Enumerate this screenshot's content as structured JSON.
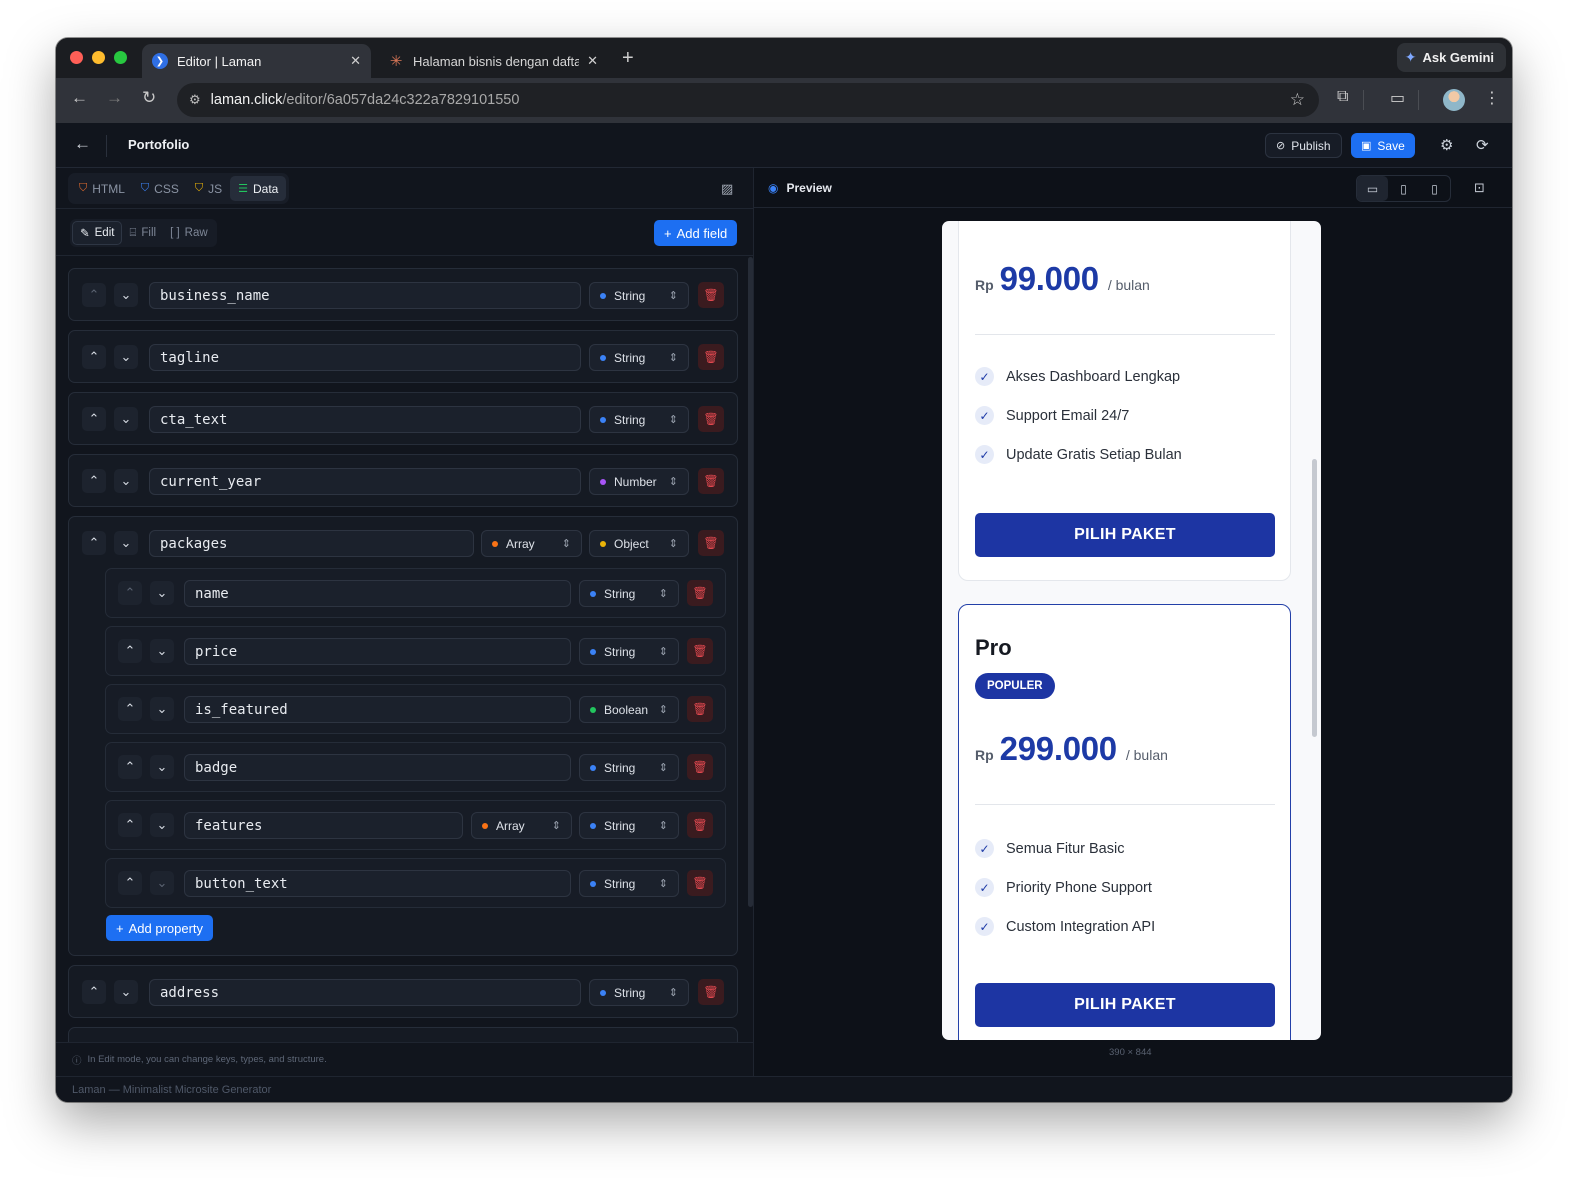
{
  "browser": {
    "tabs": [
      {
        "title": "Editor | Laman",
        "active": true
      },
      {
        "title": "Halaman bisnis dengan daftar",
        "active": false
      }
    ],
    "new_tab": "+",
    "ask_gemini": "Ask Gemini",
    "url_host": "laman.click",
    "url_path": "/editor/6a057da24c322a7829101550"
  },
  "app": {
    "project_title": "Portofolio",
    "publish_label": "Publish",
    "save_label": "Save",
    "footer": "Laman — Minimalist Microsite Generator"
  },
  "editor": {
    "lang_tabs": [
      {
        "label": "HTML",
        "icon": "html5-icon",
        "color": "#e06b2e"
      },
      {
        "label": "CSS",
        "icon": "css3-icon",
        "color": "#3b82f6"
      },
      {
        "label": "JS",
        "icon": "js-icon",
        "color": "#eab308"
      },
      {
        "label": "Data",
        "icon": "database-icon",
        "color": "#22c55e",
        "active": true
      }
    ],
    "modes": [
      {
        "label": "Edit",
        "active": true
      },
      {
        "label": "Fill"
      },
      {
        "label": "Raw"
      }
    ],
    "add_field_label": "Add field",
    "add_property_label": "Add property",
    "hint": "In Edit mode, you can change keys, types, and structure.",
    "fields": [
      {
        "key": "business_name",
        "type": "String"
      },
      {
        "key": "tagline",
        "type": "String"
      },
      {
        "key": "cta_text",
        "type": "String"
      },
      {
        "key": "current_year",
        "type": "Number"
      },
      {
        "key": "packages",
        "container": "Array",
        "type": "Object"
      },
      {
        "key": "address",
        "type": "String"
      }
    ],
    "nested_fields": [
      {
        "key": "name",
        "type": "String"
      },
      {
        "key": "price",
        "type": "String"
      },
      {
        "key": "is_featured",
        "type": "Boolean"
      },
      {
        "key": "badge",
        "type": "String"
      },
      {
        "key": "features",
        "container": "Array",
        "type": "String"
      },
      {
        "key": "button_text",
        "type": "String"
      }
    ],
    "type_colors": {
      "String": "#3b82f6",
      "Number": "#a855f7",
      "Boolean": "#22c55e",
      "Object": "#eab308",
      "Array": "#f97316"
    }
  },
  "preview": {
    "label": "Preview",
    "dimensions": "390 × 844",
    "cards": [
      {
        "currency": "Rp",
        "price": "99.000",
        "period": "/ bulan",
        "features": [
          "Akses Dashboard Lengkap",
          "Support Email 24/7",
          "Update Gratis Setiap Bulan"
        ],
        "button": "PILIH PAKET"
      },
      {
        "name": "Pro",
        "badge": "POPULER",
        "currency": "Rp",
        "price": "299.000",
        "period": "/ bulan",
        "features": [
          "Semua Fitur Basic",
          "Priority Phone Support",
          "Custom Integration API"
        ],
        "button": "PILIH PAKET"
      }
    ]
  },
  "colors": {
    "accent": "#1d6ff2",
    "preview_brand": "#1d35a3",
    "delete": "#e0484f"
  }
}
